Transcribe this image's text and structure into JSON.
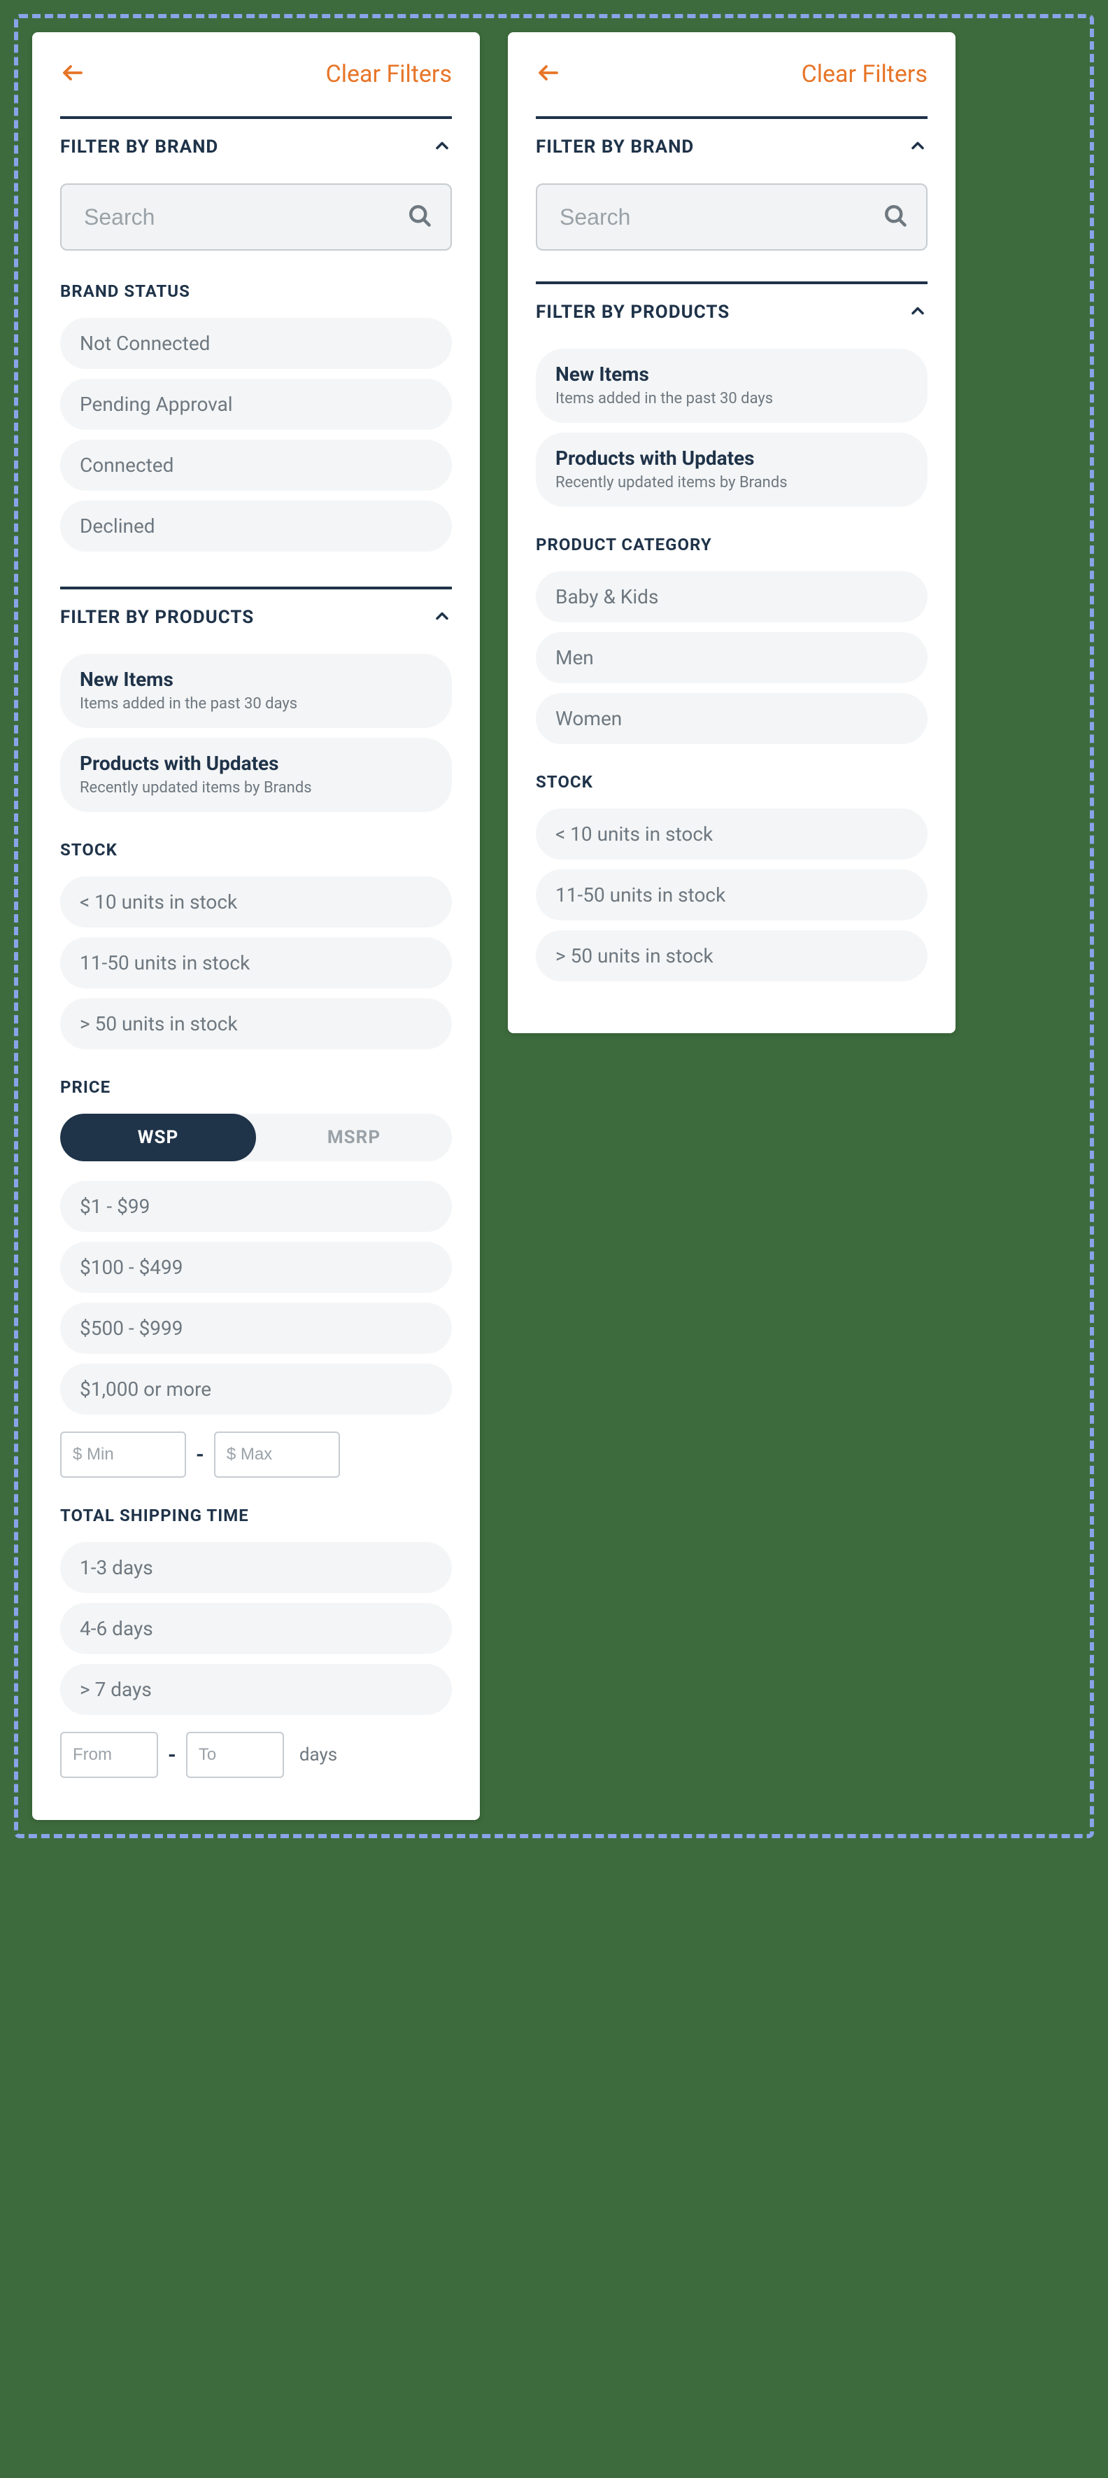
{
  "header": {
    "clear_filters": "Clear Filters"
  },
  "brand_section": {
    "title": "FILTER BY BRAND",
    "search_placeholder": "Search",
    "status_heading": "BRAND STATUS",
    "status_options": [
      "Not Connected",
      "Pending Approval",
      "Connected",
      "Declined"
    ]
  },
  "products_section": {
    "title": "FILTER BY PRODUCTS",
    "quick_filters": [
      {
        "title": "New Items",
        "sub": "Items added in the past 30 days"
      },
      {
        "title": "Products with Updates",
        "sub": "Recently updated items by Brands"
      }
    ],
    "category_heading": "PRODUCT CATEGORY",
    "categories": [
      "Baby & Kids",
      "Men",
      "Women"
    ],
    "stock_heading": "STOCK",
    "stock_options": [
      "< 10 units in stock",
      "11-50 units in stock",
      "> 50 units in stock"
    ]
  },
  "price_section": {
    "heading": "PRICE",
    "toggle": {
      "wsp": "WSP",
      "msrp": "MSRP",
      "active": "wsp"
    },
    "ranges": [
      "$1 - $99",
      "$100 - $499",
      "$500 - $999",
      "$1,000 or more"
    ],
    "min_placeholder": "$ Min",
    "max_placeholder": "$ Max"
  },
  "shipping_section": {
    "heading": "TOTAL SHIPPING TIME",
    "options": [
      "1-3 days",
      "4-6 days",
      "> 7 days"
    ],
    "from_placeholder": "From",
    "to_placeholder": "To",
    "suffix": "days"
  }
}
